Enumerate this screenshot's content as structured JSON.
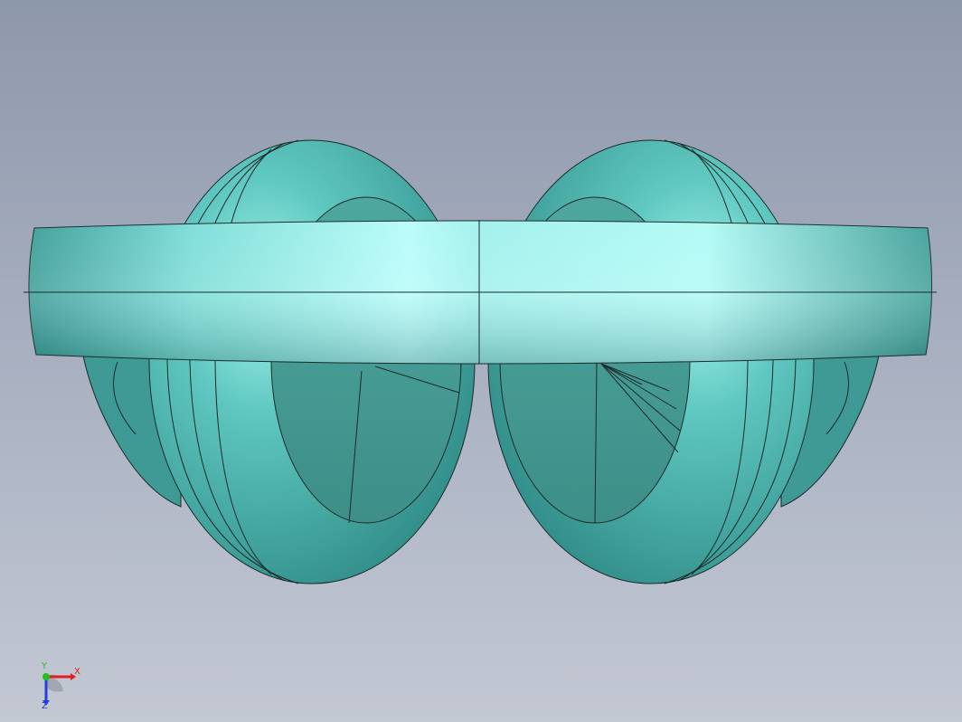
{
  "viewport": {
    "background_top": "#8e98ab",
    "background_bottom": "#c3c8d3"
  },
  "model": {
    "name": "headphones",
    "color": "#4fb4ae",
    "highlight": "#b8ffff",
    "edge_color": "#1a2a2a"
  },
  "triad": {
    "x_label": "X",
    "y_label": "Y",
    "z_label": "Z",
    "x_color": "#e02020",
    "y_color": "#20c020",
    "z_color": "#2040e0"
  }
}
